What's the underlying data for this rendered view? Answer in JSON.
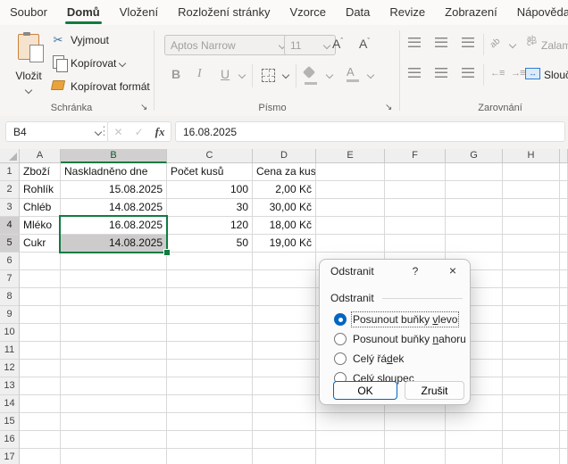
{
  "colors": {
    "accent_green": "#107C41",
    "selection_fill": "#CDCBCB",
    "selected_header_fill": "#D1CFCF",
    "radio_accent": "#0067C0"
  },
  "menubar": {
    "tabs": [
      "Soubor",
      "Domů",
      "Vložení",
      "Rozložení stránky",
      "Vzorce",
      "Data",
      "Revize",
      "Zobrazení",
      "Nápověda"
    ],
    "active_tab": "Domů"
  },
  "ribbon": {
    "clipboard": {
      "paste_label": "Vložit",
      "cut_label": "Vyjmout",
      "copy_label": "Kopírovat",
      "format_painter_label": "Kopírovat formát",
      "group_label": "Schránka"
    },
    "font": {
      "font_name": "Aptos Narrow",
      "font_size": "11",
      "bold": "B",
      "italic": "I",
      "underline": "U",
      "grow_font": "A",
      "shrink_font": "A",
      "fill_chevron": "",
      "group_label": "Písmo"
    },
    "alignment": {
      "wrap_label": "Zalam",
      "merge_label": "Slouči",
      "group_label": "Zarovnání"
    }
  },
  "formula_bar": {
    "name_box": "B4",
    "cancel_icon": "✕",
    "enter_icon": "✓",
    "fx_label": "fx",
    "value": "16.08.2025"
  },
  "grid": {
    "column_headers": [
      "A",
      "B",
      "C",
      "D",
      "E",
      "F",
      "G",
      "H"
    ],
    "selected_column": "B",
    "selected_rows": [
      4,
      5
    ],
    "row_numbers": [
      "1",
      "2",
      "3",
      "4",
      "5",
      "6",
      "7",
      "8",
      "9",
      "10",
      "11",
      "12",
      "13",
      "14",
      "15",
      "16",
      "17"
    ]
  },
  "table": {
    "headers": [
      "Zboží",
      "Naskladněno dne",
      "Počet kusů",
      "Cena za kus"
    ],
    "rows": [
      [
        "Rohlík",
        "15.08.2025",
        "100",
        "2,00 Kč"
      ],
      [
        "Chléb",
        "14.08.2025",
        "30",
        "30,00 Kč"
      ],
      [
        "Mléko",
        "16.08.2025",
        "120",
        "18,00 Kč"
      ],
      [
        "Cukr",
        "14.08.2025",
        "50",
        "19,00 Kč"
      ]
    ]
  },
  "dialog": {
    "title": "Odstranit",
    "help_icon": "?",
    "close_icon": "×",
    "group_label": "Odstranit",
    "options": [
      {
        "pre": "Posunout buňky ",
        "key": "v",
        "post": "levo",
        "selected": true
      },
      {
        "pre": "Posunout buňky ",
        "key": "n",
        "post": "ahoru",
        "selected": false
      },
      {
        "pre": "Celý řá",
        "key": "d",
        "post": "ek",
        "selected": false
      },
      {
        "pre": "Celý ",
        "key": "s",
        "post": "loupec",
        "selected": false
      }
    ],
    "ok_label": "OK",
    "cancel_label": "Zrušit"
  }
}
